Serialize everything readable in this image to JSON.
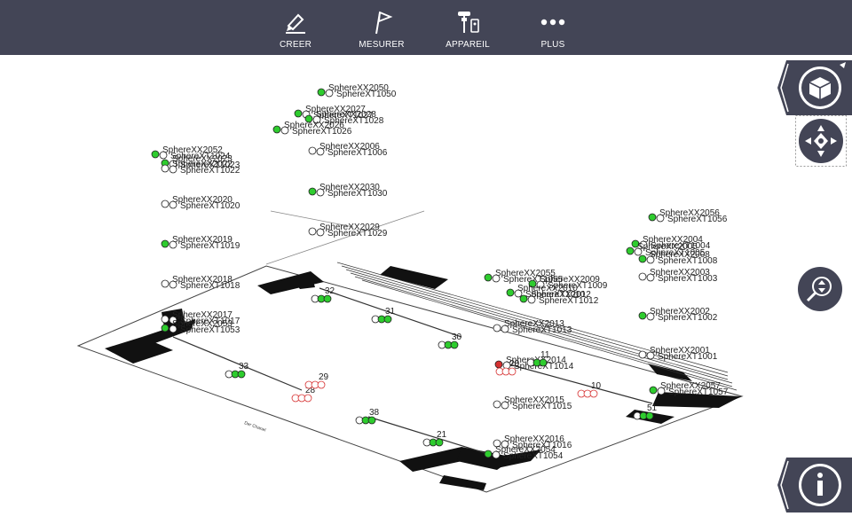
{
  "toolbar": {
    "items": [
      {
        "label": "CREER",
        "icon": "pencil-icon"
      },
      {
        "label": "MESURER",
        "icon": "flag-icon"
      },
      {
        "label": "APPAREIL",
        "icon": "instrument-icon"
      },
      {
        "label": "PLUS",
        "icon": "more-dots-icon"
      }
    ]
  },
  "colors": {
    "toolbar_bg": "#434556",
    "button_bg": "#434556",
    "point_measured": "#2ecc2e",
    "point_error": "#d63030",
    "point_unmeasured": "#ffffff"
  },
  "side_buttons": [
    {
      "name": "view-cube-button",
      "icon": "cube-icon"
    },
    {
      "name": "navigate-button",
      "icon": "navigation-icon"
    },
    {
      "name": "zoom-button",
      "icon": "zoom-icon"
    },
    {
      "name": "info-button",
      "icon": "info-icon"
    }
  ],
  "scene": {
    "plan_note": "Der Chanel",
    "points": [
      {
        "label": "SphereXX2050",
        "sub": "SphereXT1050"
      },
      {
        "label": "SphereXX2027",
        "sub": "SphereXT1027"
      },
      {
        "label": "SphereXX2028",
        "sub": "SphereXT1028"
      },
      {
        "label": "SphereXX2026",
        "sub": "SphereXT1026"
      },
      {
        "label": "SphereXX2006",
        "sub": "SphereXT1006"
      },
      {
        "label": "SphereXX2030",
        "sub": "SphereXT1030"
      },
      {
        "label": "SphereXX2029",
        "sub": "SphereXT1029"
      },
      {
        "label": "SphereXX2052",
        "sub": "SphereXT1024"
      },
      {
        "label": "SphereXX2023",
        "sub": "SphereXT1023"
      },
      {
        "label": "SphereXX2022",
        "sub": "SphereXT1022"
      },
      {
        "label": "SphereXX2020",
        "sub": "SphereXT1020"
      },
      {
        "label": "SphereXX2019",
        "sub": "SphereXT1019"
      },
      {
        "label": "SphereXX2018",
        "sub": "SphereXT1018"
      },
      {
        "label": "SphereXX2017",
        "sub": "SphereXT1017"
      },
      {
        "label": "SphereXX2053",
        "sub": "SphereXT1053"
      },
      {
        "label": "SphereXX2055",
        "sub": "SphereXT1055"
      },
      {
        "label": "SphereXX2009",
        "sub": "SphereXT1009"
      },
      {
        "label": "SphereXX2010",
        "sub": "SphereXT1010"
      },
      {
        "label": "SphereXX2012",
        "sub": "SphereXT1012"
      },
      {
        "label": "SphereXX2013",
        "sub": "SphereXT1013"
      },
      {
        "label": "SphereXX2014",
        "sub": "SphereXT1014"
      },
      {
        "label": "SphereXX2015",
        "sub": "SphereXT1015"
      },
      {
        "label": "SphereXX2016",
        "sub": "SphereXT1016"
      },
      {
        "label": "SphereXX2054",
        "sub": "SphereXT1054"
      },
      {
        "label": "SphereXX2056",
        "sub": "SphereXT1056"
      },
      {
        "label": "SphereXX2004",
        "sub": "SphereXT1004"
      },
      {
        "label": "SphereXX2005",
        "sub": "SphereXT1005"
      },
      {
        "label": "SphereXX2008",
        "sub": "SphereXT1008"
      },
      {
        "label": "SphereXX2003",
        "sub": "SphereXT1003"
      },
      {
        "label": "SphereXX2002",
        "sub": "SphereXT1002"
      },
      {
        "label": "SphereXX2001",
        "sub": "SphereXT1001"
      },
      {
        "label": "SphereXX2057",
        "sub": "SphereXT1057"
      }
    ],
    "station_numbers": [
      "31",
      "30",
      "32",
      "33",
      "28",
      "29",
      "11",
      "10",
      "38",
      "21",
      "20",
      "51"
    ]
  }
}
